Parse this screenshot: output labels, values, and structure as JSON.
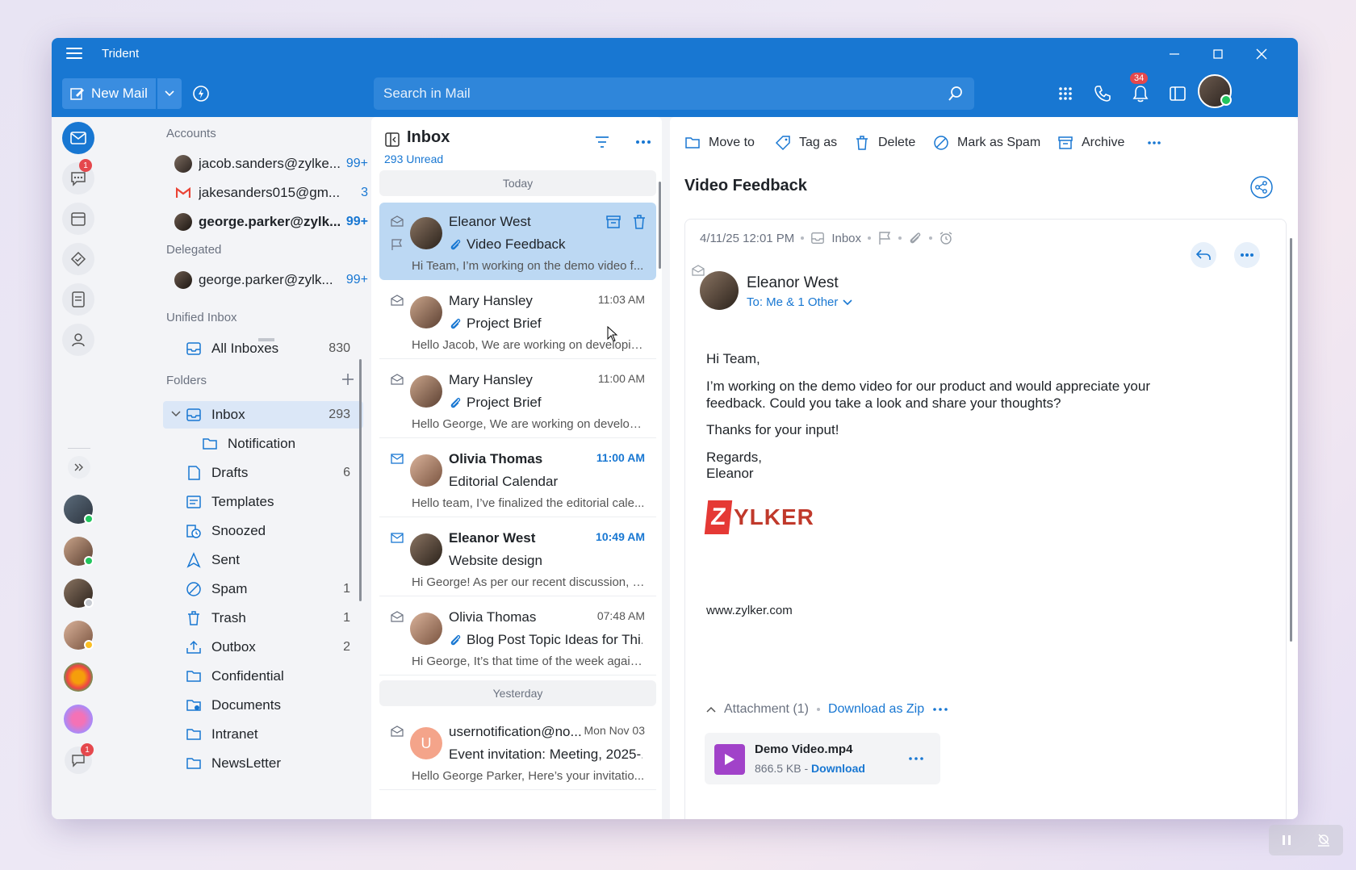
{
  "app": {
    "title": "Trident"
  },
  "toolbar": {
    "new_mail_label": "New Mail",
    "search_placeholder": "Search in Mail",
    "notifications_count": "34"
  },
  "rail": {
    "chat_badge": "1",
    "bottom_badge": "1"
  },
  "folders_pane": {
    "accounts_label": "Accounts",
    "accounts": [
      {
        "name": "jacob.sanders@zylke...",
        "count": "99+"
      },
      {
        "name": "jakesanders015@gm...",
        "count": "3"
      },
      {
        "name": "george.parker@zylk...",
        "count": "99+"
      }
    ],
    "delegated_label": "Delegated",
    "delegated": [
      {
        "name": "george.parker@zylk...",
        "count": "99+"
      }
    ],
    "unified_label": "Unified Inbox",
    "all_inboxes": {
      "name": "All Inboxes",
      "count": "830"
    },
    "folders_label": "Folders",
    "folders": [
      {
        "name": "Inbox",
        "count": "293"
      },
      {
        "name": "Notification",
        "count": ""
      },
      {
        "name": "Drafts",
        "count": "6"
      },
      {
        "name": "Templates",
        "count": ""
      },
      {
        "name": "Snoozed",
        "count": ""
      },
      {
        "name": "Sent",
        "count": ""
      },
      {
        "name": "Spam",
        "count": "1"
      },
      {
        "name": "Trash",
        "count": "1"
      },
      {
        "name": "Outbox",
        "count": "2"
      },
      {
        "name": "Confidential",
        "count": ""
      },
      {
        "name": "Documents",
        "count": ""
      },
      {
        "name": "Intranet",
        "count": ""
      },
      {
        "name": "NewsLetter",
        "count": ""
      }
    ]
  },
  "mail_list": {
    "title": "Inbox",
    "unread": "293 Unread",
    "day_today": "Today",
    "day_yesterday": "Yesterday",
    "items": [
      {
        "from": "Eleanor West",
        "time": "",
        "subject": "Video Feedback",
        "preview": "Hi Team, I’m working on the demo video f..."
      },
      {
        "from": "Mary Hansley",
        "time": "11:03 AM",
        "subject": "Project Brief",
        "preview": "Hello Jacob, We are working on developin..."
      },
      {
        "from": "Mary Hansley",
        "time": "11:00 AM",
        "subject": "Project Brief",
        "preview": "Hello George, We are working on develop..."
      },
      {
        "from": "Olivia Thomas",
        "time": "11:00 AM",
        "subject": "Editorial Calendar",
        "preview": "Hello team, I’ve finalized the editorial cale..."
      },
      {
        "from": "Eleanor West",
        "time": "10:49 AM",
        "subject": "Website design",
        "preview": "Hi George! As per our recent discussion, I..."
      },
      {
        "from": "Olivia Thomas",
        "time": "07:48 AM",
        "subject": "Blog Post Topic Ideas for Thi...",
        "preview": "Hi George, It’s that time of the week again..."
      },
      {
        "from": "usernotification@no...",
        "time": "Mon Nov 03",
        "subject": "Event invitation: Meeting, 2025-...",
        "preview": "Hello George Parker, Here’s your invitatio...",
        "initial": "U"
      }
    ]
  },
  "reading": {
    "actions": {
      "move": "Move to",
      "tag": "Tag as",
      "delete": "Delete",
      "spam": "Mark as Spam",
      "archive": "Archive"
    },
    "subject": "Video Feedback",
    "datetime": "4/11/25 12:01 PM",
    "folder": "Inbox",
    "sender": "Eleanor West",
    "to": "To: Me & 1 Other",
    "body": {
      "greeting": "Hi Team,",
      "para1": "I’m working on the demo video for our product and would appreciate your feedback. Could you take a look and share your thoughts?",
      "para2": "Thanks for your input!",
      "regards": "Regards,",
      "signature": "Eleanor"
    },
    "logo_z": "Z",
    "logo_text": "YLKER",
    "website": "www.zylker.com",
    "attachment_label": "Attachment (1)",
    "download_zip": "Download as Zip",
    "file": {
      "name": "Demo Video.mp4",
      "size": "866.5 KB - ",
      "download": "Download"
    }
  },
  "colors": {
    "accent": "#1877d2",
    "selected_row": "#bcd8f3",
    "badge": "#e5484d"
  }
}
